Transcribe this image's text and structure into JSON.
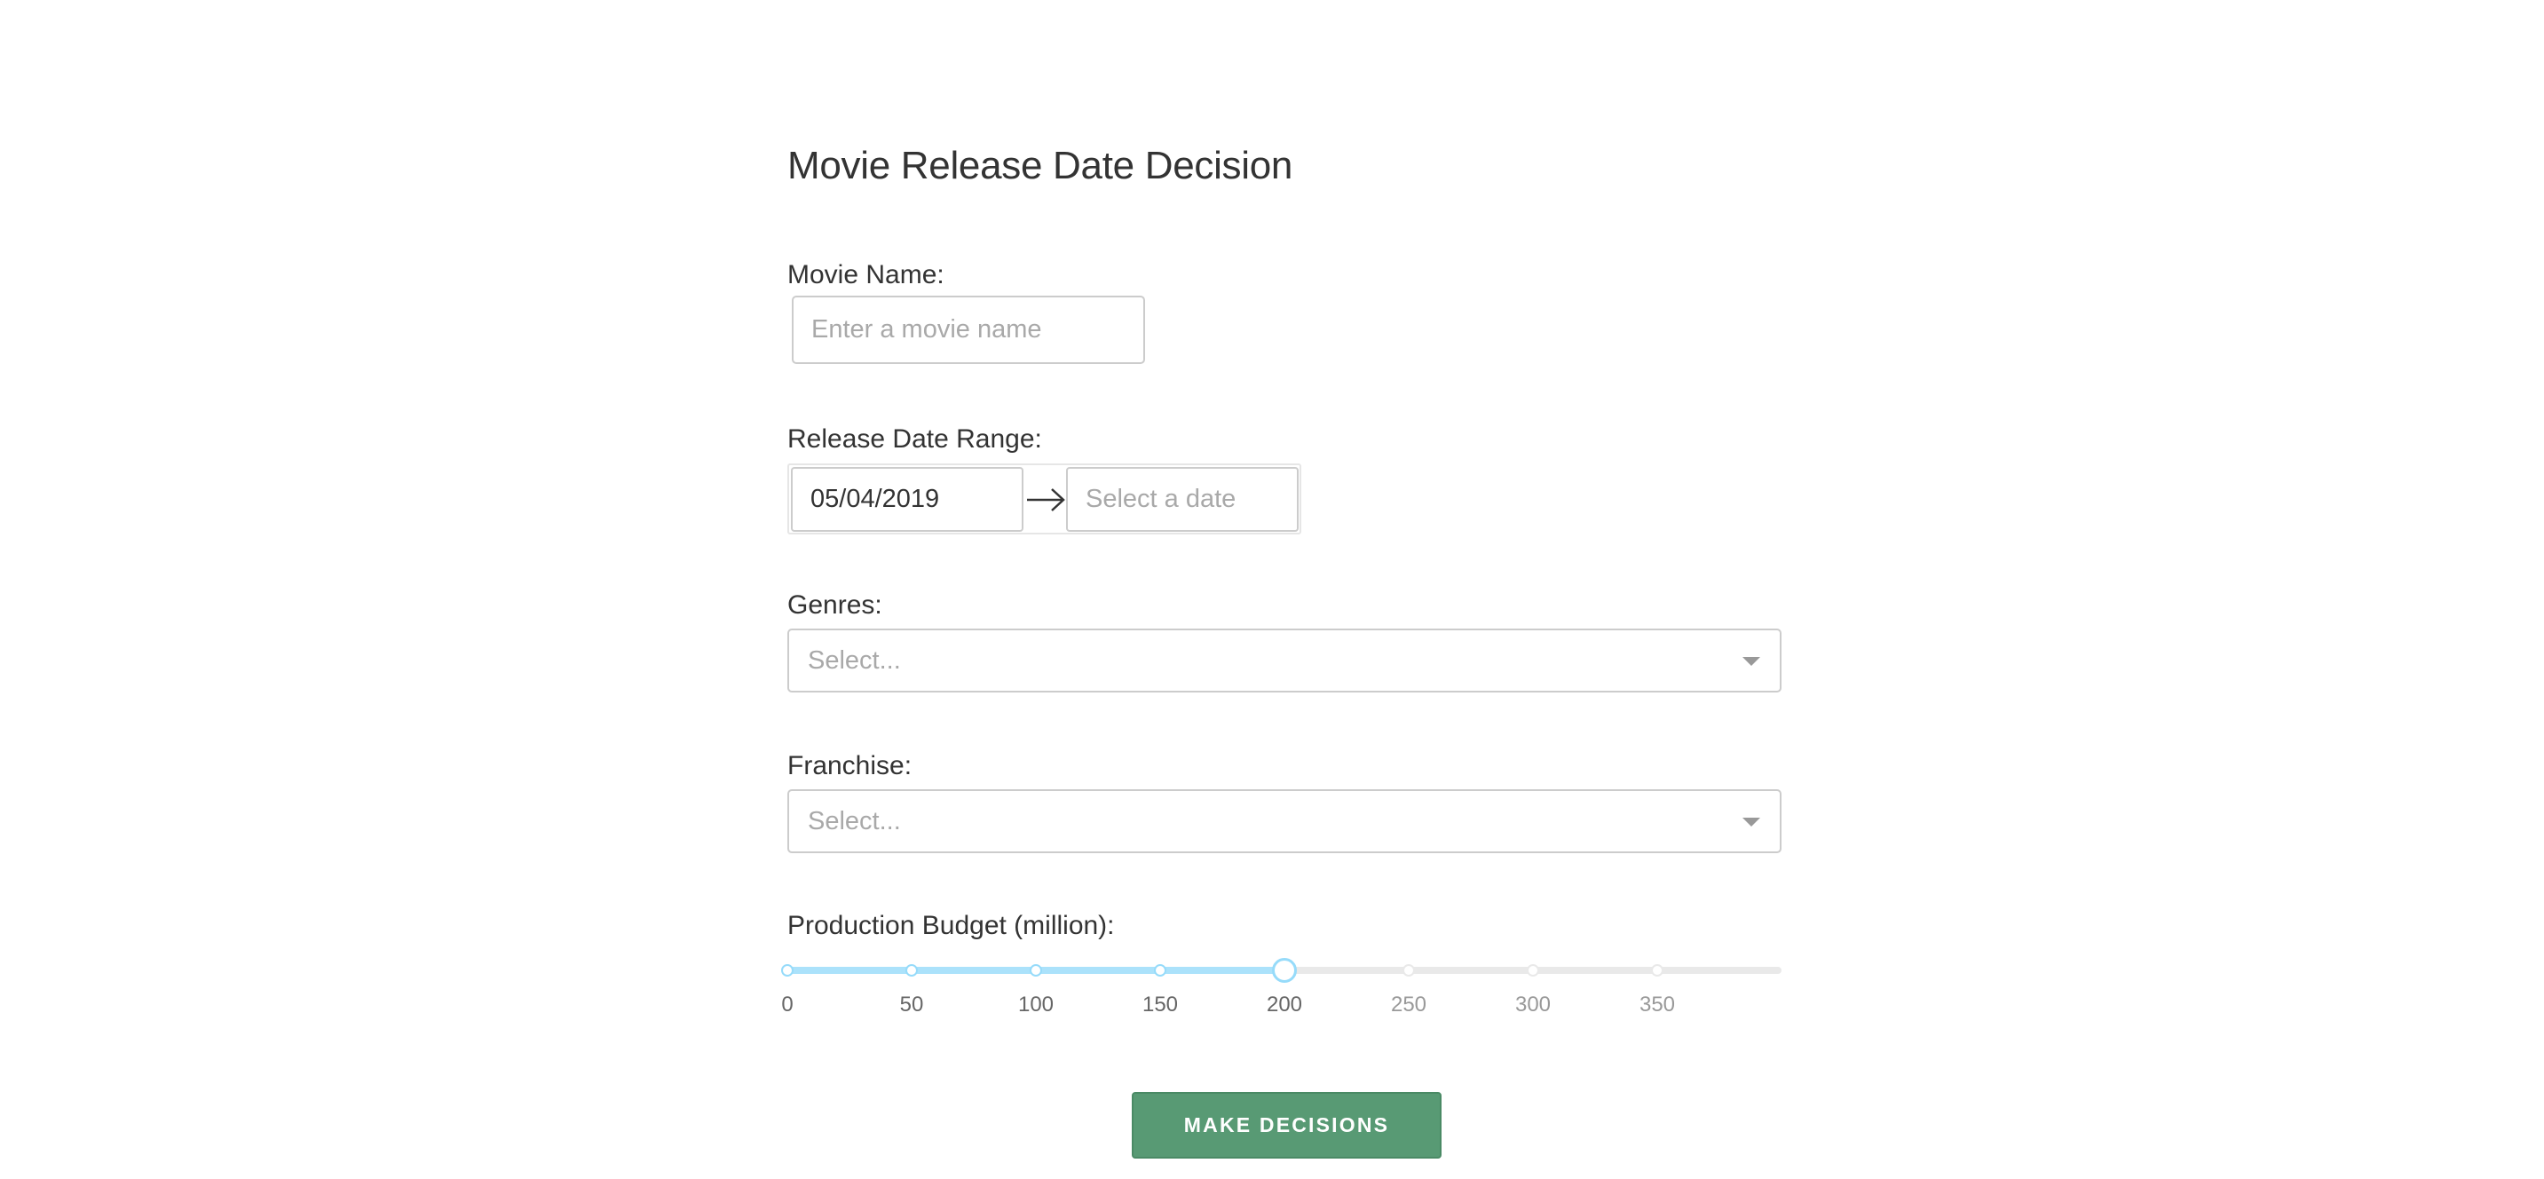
{
  "page": {
    "title": "Movie Release Date Decision"
  },
  "movie_name": {
    "label": "Movie Name:",
    "value": "",
    "placeholder": "Enter a movie name"
  },
  "release_date_range": {
    "label": "Release Date Range:",
    "start_value": "05/04/2019",
    "end_placeholder": "Select a date",
    "separator_icon": "arrow-right-icon"
  },
  "genres": {
    "label": "Genres:",
    "placeholder": "Select...",
    "icon": "chevron-down-icon"
  },
  "franchise": {
    "label": "Franchise:",
    "placeholder": "Select...",
    "icon": "chevron-down-icon"
  },
  "budget": {
    "label": "Production Budget (million):",
    "min": 0,
    "max": 400,
    "value": 200,
    "marks": [
      "0",
      "50",
      "100",
      "150",
      "200",
      "250",
      "300",
      "350"
    ],
    "mark_values": [
      0,
      50,
      100,
      150,
      200,
      250,
      300,
      350
    ],
    "colors": {
      "track": "#abe2fb",
      "handle": "#96dbfa",
      "rail": "#e9e9e9"
    }
  },
  "submit": {
    "label": "MAKE DECISIONS",
    "color": "#589a74"
  }
}
